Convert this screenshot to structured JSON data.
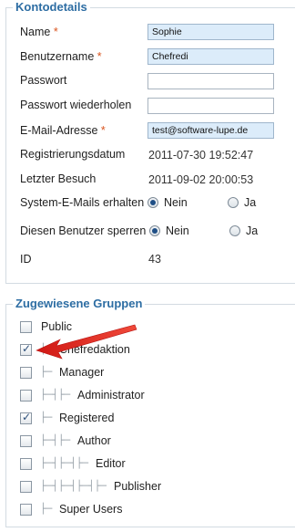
{
  "account": {
    "legend": "Kontodetails",
    "name": {
      "label": "Name",
      "required": "*",
      "value": "Sophie"
    },
    "username": {
      "label": "Benutzername",
      "required": "*",
      "value": "Chefredi"
    },
    "password": {
      "label": "Passwort",
      "value": ""
    },
    "password_repeat": {
      "label": "Passwort wiederholen",
      "value": ""
    },
    "email": {
      "label": "E-Mail-Adresse",
      "required": "*",
      "value": "test@software-lupe.de"
    },
    "registered": {
      "label": "Registrierungsdatum",
      "value": "2011-07-30 19:52:47"
    },
    "last_visit": {
      "label": "Letzter Besuch",
      "value": "2011-09-02 20:00:53"
    },
    "system_mails": {
      "label": "System-E-Mails erhalten",
      "option_no": "Nein",
      "option_yes": "Ja",
      "selected": "Nein"
    },
    "block_user": {
      "label": "Diesen Benutzer sperren",
      "option_no": "Nein",
      "option_yes": "Ja",
      "selected": "Nein"
    },
    "id": {
      "label": "ID",
      "value": "43"
    }
  },
  "groups": {
    "legend": "Zugewiesene Gruppen",
    "items": [
      {
        "label": "Public",
        "checked": false,
        "depth": 0
      },
      {
        "label": "Chefredaktion",
        "checked": true,
        "depth": 1
      },
      {
        "label": "Manager",
        "checked": false,
        "depth": 1
      },
      {
        "label": "Administrator",
        "checked": false,
        "depth": 2
      },
      {
        "label": "Registered",
        "checked": true,
        "depth": 1
      },
      {
        "label": "Author",
        "checked": false,
        "depth": 2
      },
      {
        "label": "Editor",
        "checked": false,
        "depth": 3
      },
      {
        "label": "Publisher",
        "checked": false,
        "depth": 4
      },
      {
        "label": "Super Users",
        "checked": false,
        "depth": 1
      }
    ]
  },
  "colors": {
    "accent": "#2d6da3",
    "required": "#d9541e",
    "filled_input": "#dcecfa",
    "arrow": "#e0201b"
  }
}
